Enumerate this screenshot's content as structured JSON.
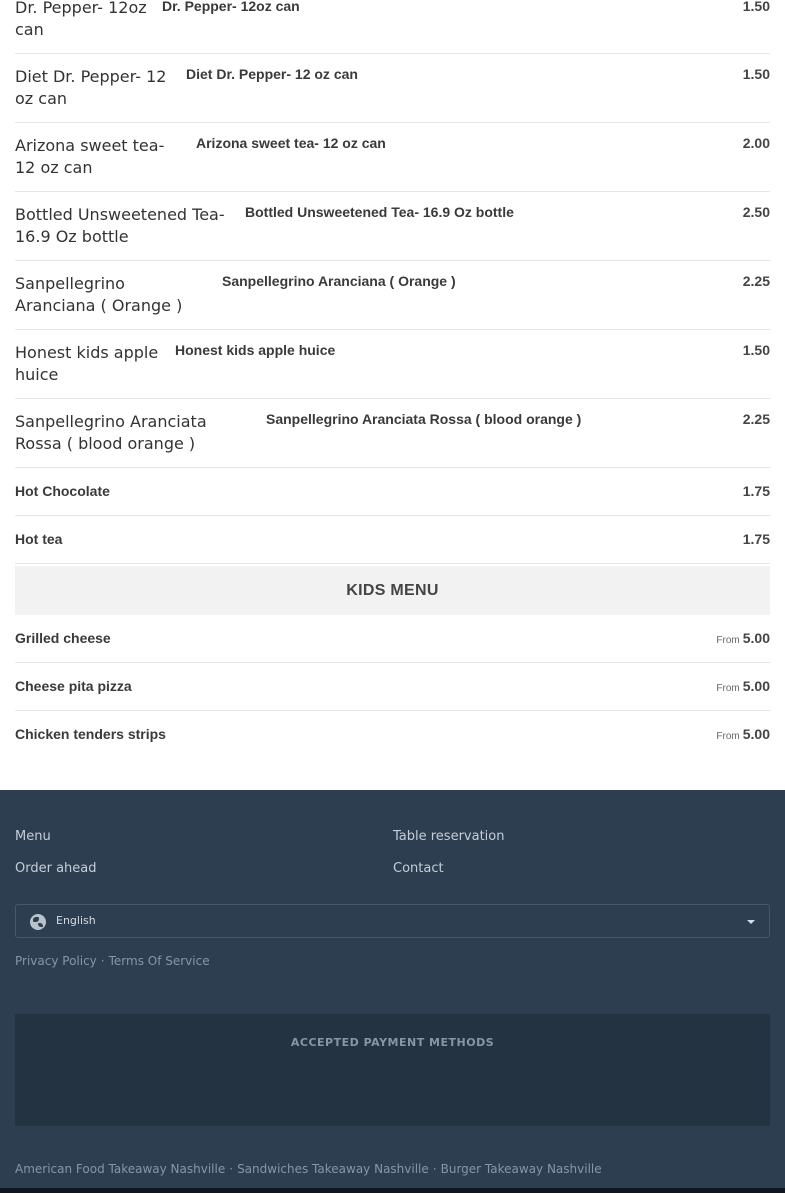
{
  "drinks": [
    {
      "alt": "Dr. Pepper- 12oz can",
      "name": "Dr. Pepper- 12oz can",
      "price": "1.50"
    },
    {
      "alt": "Diet Dr. Pepper- 12 oz can",
      "name": "Diet Dr. Pepper- 12 oz can",
      "price": "1.50"
    },
    {
      "alt": "Arizona sweet tea- 12 oz can",
      "name": "Arizona sweet tea- 12 oz can",
      "price": "2.00"
    },
    {
      "alt": "Bottled Unsweetened Tea- 16.9 Oz bottle",
      "name": "Bottled Unsweetened Tea- 16.9 Oz bottle",
      "price": "2.50"
    },
    {
      "alt": "Sanpellegrino Aranciana ( Orange )",
      "name": "Sanpellegrino Aranciana ( Orange )",
      "price": "2.25"
    },
    {
      "alt": "Honest kids apple huice",
      "name": "Honest kids apple huice",
      "price": "1.50"
    },
    {
      "alt": "Sanpellegrino Aranciata Rossa ( blood orange )",
      "name": "Sanpellegrino Aranciata Rossa ( blood orange )",
      "price": "2.25"
    }
  ],
  "plain_items": [
    {
      "name": "Hot Chocolate",
      "price": "1.75"
    },
    {
      "name": "Hot tea",
      "price": "1.75"
    }
  ],
  "kids_section": {
    "title": "KIDS MENU",
    "items": [
      {
        "name": "Grilled cheese",
        "from": "From",
        "price": "5.00"
      },
      {
        "name": "Cheese pita pizza",
        "from": "From",
        "price": "5.00"
      },
      {
        "name": "Chicken tenders strips",
        "from": "From",
        "price": "5.00"
      }
    ]
  },
  "footer": {
    "links": {
      "menu": "Menu",
      "reservation": "Table reservation",
      "order": "Order ahead",
      "contact": "Contact"
    },
    "language": {
      "selected": "English",
      "icon": "globe-icon"
    },
    "legal": {
      "privacy": "Privacy Policy",
      "terms": "Terms Of Service",
      "separator": "·"
    },
    "payments_title": "ACCEPTED PAYMENT METHODS",
    "seo_links": [
      "American Food Takeaway Nashville",
      "Sandwiches Takeaway Nashville",
      "Burger Takeaway Nashville"
    ],
    "colors": {
      "background": "#2c3e50",
      "panel": "#233342"
    }
  }
}
